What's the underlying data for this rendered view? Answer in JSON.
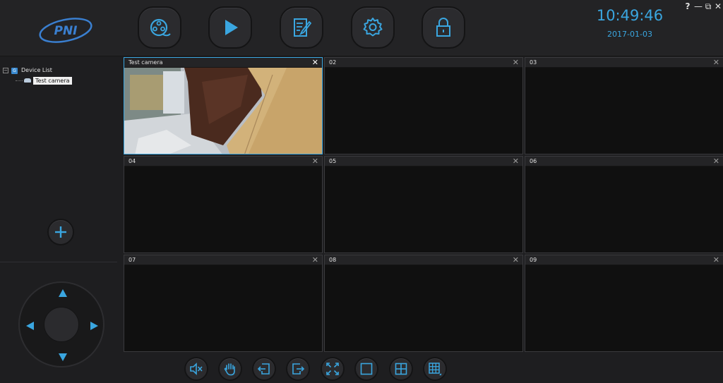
{
  "header": {
    "logo_text": "PNI",
    "clock_time": "10:49:46",
    "clock_date": "2017-01-03",
    "nav": [
      {
        "name": "live-view",
        "icon": "film-reel-icon"
      },
      {
        "name": "playback",
        "icon": "play-icon"
      },
      {
        "name": "log",
        "icon": "document-edit-icon"
      },
      {
        "name": "settings",
        "icon": "gear-icon"
      },
      {
        "name": "lock",
        "icon": "lock-icon"
      }
    ],
    "window_controls": {
      "help": "?",
      "minimize": "—",
      "restore": "⧉",
      "close": "✕"
    }
  },
  "sidebar": {
    "tree_root_label": "Device List",
    "tree_toggle": "⊟",
    "tree_items": [
      {
        "label": "Test camera"
      }
    ]
  },
  "grid": {
    "cells": [
      {
        "title": "Test camera",
        "active": true,
        "has_video": true
      },
      {
        "title": "02"
      },
      {
        "title": "03"
      },
      {
        "title": "04"
      },
      {
        "title": "05"
      },
      {
        "title": "06"
      },
      {
        "title": "07"
      },
      {
        "title": "08"
      },
      {
        "title": "09"
      }
    ],
    "close_glyph": "✕"
  },
  "toolbar": {
    "buttons": [
      {
        "name": "mute",
        "icon": "speaker-mute-icon"
      },
      {
        "name": "hand",
        "icon": "hand-icon"
      },
      {
        "name": "previous-page",
        "icon": "page-back-icon"
      },
      {
        "name": "next-page",
        "icon": "page-forward-icon"
      },
      {
        "name": "fullscreen",
        "icon": "fullscreen-icon"
      },
      {
        "name": "layout-1",
        "icon": "single-view-icon"
      },
      {
        "name": "layout-4",
        "icon": "quad-view-icon"
      },
      {
        "name": "layout-9",
        "icon": "nine-view-icon"
      }
    ]
  },
  "colors": {
    "accent": "#3aa6e0",
    "background": "#1e1e20",
    "active_border": "#3aa6e0"
  }
}
